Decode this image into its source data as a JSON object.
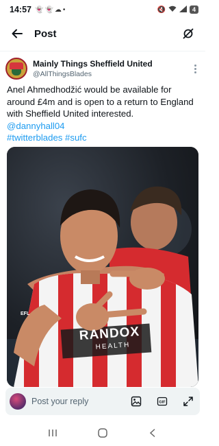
{
  "status_bar": {
    "time": "14:57",
    "battery": "4",
    "notification_icons": [
      "snapchat-icon",
      "snapchat-icon",
      "cloud-icon",
      "dot-icon"
    ],
    "system_icons": [
      "mute-icon",
      "wifi-icon",
      "signal-icon",
      "battery-icon"
    ]
  },
  "header": {
    "title": "Post"
  },
  "tweet": {
    "author": {
      "display_name": "Mainly Things Sheffield United",
      "handle": "@AllThingsBlades"
    },
    "text_lines": [
      "Anel Ahmedhodžić would be available for",
      "around £4m and is open to a return to England",
      "with Sheffield United interested."
    ],
    "mention": "@dannyhall04",
    "hashtags": "#twitterblades #sufc",
    "media": {
      "shirt_sponsor": "RANDOX",
      "shirt_sponsor_sub": "HEALTH",
      "sleeve_badge": "EFL"
    }
  },
  "reply": {
    "placeholder": "Post your reply"
  },
  "colors": {
    "link": "#1d9bf0",
    "secondary_text": "#536471",
    "reply_bar_bg": "#eff3f4",
    "kit_red": "#d52b2f",
    "kit_white": "#f4f4f4"
  }
}
